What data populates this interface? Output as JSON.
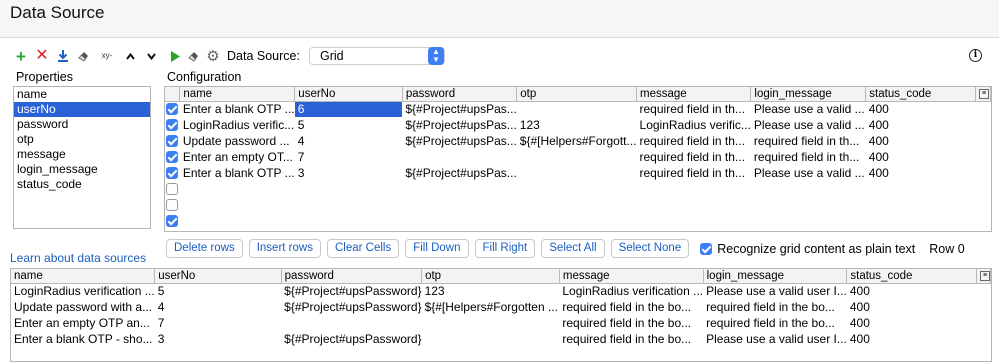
{
  "window": {
    "title": "Data Source"
  },
  "toolbar": {
    "icons": [
      "add-icon",
      "delete-icon",
      "download-icon",
      "eraser-icon",
      "xy-icon",
      "chevron-up-icon",
      "chevron-down-icon",
      "run-icon",
      "eraser-icon",
      "gear-icon"
    ],
    "xy_label": "xy-",
    "datasource_label": "Data Source:",
    "datasource_value": "Grid"
  },
  "colors": {
    "accent": "#3b7ef5",
    "selection": "#2b61d6",
    "link": "#1b5fbf",
    "add_green": "#2aa52a",
    "delete_red": "#e02222"
  },
  "properties": {
    "label": "Properties",
    "items": [
      "name",
      "userNo",
      "password",
      "otp",
      "message",
      "login_message",
      "status_code"
    ],
    "selected_index": 1
  },
  "learn_link": "Learn about data sources",
  "configuration": {
    "label": "Configuration",
    "columns": [
      "name",
      "userNo",
      "password",
      "otp",
      "message",
      "login_message",
      "status_code"
    ],
    "rows": [
      {
        "checked": true,
        "cells": [
          "Enter a blank OTP ...",
          "6",
          "${#Project#upsPas...",
          "",
          "required field in th...",
          "Please use a valid ...",
          "400"
        ]
      },
      {
        "checked": true,
        "cells": [
          "LoginRadius verific...",
          "5",
          "${#Project#upsPas...",
          "123",
          "LoginRadius verific...",
          "Please use a valid ...",
          "400"
        ]
      },
      {
        "checked": true,
        "cells": [
          "Update password ...",
          "4",
          "${#Project#upsPas...",
          "${#[Helpers#Forgott...",
          "required field in th...",
          "required field in th...",
          "400"
        ]
      },
      {
        "checked": true,
        "cells": [
          "Enter an empty OT...",
          "7",
          "",
          "",
          "required field in th...",
          "required field in th...",
          "400"
        ]
      },
      {
        "checked": true,
        "cells": [
          "Enter a blank OTP ...",
          "3",
          "${#Project#upsPas...",
          "",
          "required field in th...",
          "Please use a valid ...",
          "400"
        ]
      },
      {
        "checked": false,
        "cells": [
          "",
          "",
          "",
          "",
          "",
          "",
          ""
        ]
      },
      {
        "checked": false,
        "cells": [
          "",
          "",
          "",
          "",
          "",
          "",
          ""
        ]
      },
      {
        "checked": true,
        "cells": [
          "",
          "",
          "",
          "",
          "",
          "",
          ""
        ]
      }
    ]
  },
  "buttons": [
    "Delete rows",
    "Insert rows",
    "Clear Cells",
    "Fill Down",
    "Fill Right",
    "Select All",
    "Select None"
  ],
  "plain_text_checkbox": {
    "label": "Recognize grid content as plain text",
    "checked": true
  },
  "row_indicator": "Row 0",
  "preview": {
    "columns": [
      "name",
      "userNo",
      "password",
      "otp",
      "message",
      "login_message",
      "status_code"
    ],
    "rows": [
      [
        "LoginRadius verification ...",
        "5",
        "${#Project#upsPassword}",
        "123",
        "LoginRadius verification ...",
        "Please use a valid user I...",
        "400"
      ],
      [
        "Update password with a...",
        "4",
        "${#Project#upsPassword}",
        "${#[Helpers#Forgotten ...",
        "required field in the bo...",
        "required field in the bo...",
        "400"
      ],
      [
        "Enter an empty OTP an...",
        "7",
        "",
        "",
        "required field in the bo...",
        "required field in the bo...",
        "400"
      ],
      [
        "Enter a blank OTP - sho...",
        "3",
        "${#Project#upsPassword}",
        "",
        "required field in the bo...",
        "Please use a valid user I...",
        "400"
      ]
    ]
  }
}
